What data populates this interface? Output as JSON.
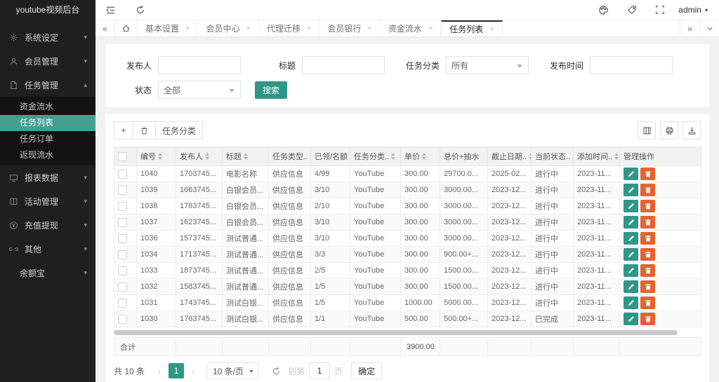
{
  "app": {
    "user": "admin"
  },
  "icons": {
    "tabs_left": "«",
    "tabs_right": "»",
    "close": "×",
    "plus": "+",
    "caret_down": "▾",
    "caret_up": "▴",
    "prev": "‹",
    "next": "›"
  },
  "colors": {
    "accent_green": "#2F9688",
    "sidebar_active_green": "#42A08E",
    "danger_orange": "#EB6031",
    "sidebar_bg": "#1f1f1f"
  },
  "sidebar": {
    "title": "youtube视频后台",
    "items": [
      {
        "label": "系统设定"
      },
      {
        "label": "会员管理"
      },
      {
        "label": "任务管理"
      },
      {
        "label": "报表数据"
      },
      {
        "label": "活动管理"
      },
      {
        "label": "充值提现"
      },
      {
        "label": "其他"
      },
      {
        "label": "余额宝"
      }
    ],
    "task_submenu": [
      "资金流水",
      "任务列表",
      "任务订单",
      "返现流水"
    ],
    "active_item": "任务列表"
  },
  "tabs": {
    "items": [
      {
        "label": "基本设置"
      },
      {
        "label": "会员中心"
      },
      {
        "label": "代理迁移"
      },
      {
        "label": "会员银行"
      },
      {
        "label": "资金流水"
      },
      {
        "label": "任务列表"
      }
    ],
    "active": "任务列表"
  },
  "filters": {
    "publisher_label": "发布人",
    "title_label": "标题",
    "category_label": "任务分类",
    "category_value": "所有",
    "time_label": "发布时间",
    "status_label": "状态",
    "status_value": "全部",
    "search_label": "搜索"
  },
  "toolbar": {
    "category_button": "任务分类"
  },
  "table": {
    "columns": [
      {
        "label": "编号"
      },
      {
        "label": "发布人"
      },
      {
        "label": "标题"
      },
      {
        "label": "任务类型.."
      },
      {
        "label": "已领/名额"
      },
      {
        "label": "任务分类.."
      },
      {
        "label": "单价"
      },
      {
        "label": "总价+抽水"
      },
      {
        "label": "截止日期.."
      },
      {
        "label": "当前状态.."
      },
      {
        "label": "添加时间.."
      },
      {
        "label": "管理操作"
      }
    ],
    "rows": [
      {
        "cells": [
          "1040",
          "1703745...",
          "电影名称",
          "供应信息",
          "4/99",
          "YouTube",
          "300.00",
          "29700.0...",
          "2025-02...",
          "进行中",
          "2023-11..."
        ]
      },
      {
        "cells": [
          "1039",
          "1663745...",
          "白银会员...",
          "供应信息",
          "3/10",
          "YouTube",
          "300.00",
          "3000.00...",
          "2023-12...",
          "进行中",
          "2023-11..."
        ]
      },
      {
        "cells": [
          "1038",
          "1783745...",
          "白银会员...",
          "供应信息",
          "2/10",
          "YouTube",
          "300.00",
          "3000.00...",
          "2023-12...",
          "进行中",
          "2023-11..."
        ]
      },
      {
        "cells": [
          "1037",
          "1623745...",
          "白银会员...",
          "供应信息",
          "3/10",
          "YouTube",
          "300.00",
          "3000.00...",
          "2023-12...",
          "进行中",
          "2023-11..."
        ]
      },
      {
        "cells": [
          "1036",
          "1573745...",
          "测试普通...",
          "供应信息",
          "3/10",
          "YouTube",
          "300.00",
          "3000.00...",
          "2023-12...",
          "进行中",
          "2023-11..."
        ]
      },
      {
        "cells": [
          "1034",
          "1713745...",
          "测试普通...",
          "供应信息",
          "3/3",
          "YouTube",
          "300.00",
          "900.00+...",
          "2023-12...",
          "进行中",
          "2023-11..."
        ]
      },
      {
        "cells": [
          "1033",
          "1873745...",
          "测试普通...",
          "供应信息",
          "2/5",
          "YouTube",
          "300.00",
          "1500.00...",
          "2023-12...",
          "进行中",
          "2023-11..."
        ]
      },
      {
        "cells": [
          "1032",
          "1583745...",
          "测试普通...",
          "供应信息",
          "1/5",
          "YouTube",
          "300.00",
          "1500.00...",
          "2023-12...",
          "进行中",
          "2023-11..."
        ]
      },
      {
        "cells": [
          "1031",
          "1743745...",
          "测试白银...",
          "供应信息",
          "1/5",
          "YouTube",
          "1000.00",
          "5000.00...",
          "2023-12...",
          "进行中",
          "2023-11..."
        ]
      },
      {
        "cells": [
          "1030",
          "1763745...",
          "测试白银...",
          "供应信息",
          "1/1",
          "YouTube",
          "500.00",
          "500.00+...",
          "2023-12...",
          "已完成",
          "2023-11..."
        ]
      }
    ],
    "sum_label": "合计",
    "sum_unit_price": "3900.00"
  },
  "pagination": {
    "total": "共 10 条",
    "current_page": "1",
    "page_size": "10 条/页",
    "goto_label": "到第",
    "goto_value": "1",
    "page_unit": "页",
    "confirm_label": "确定"
  }
}
